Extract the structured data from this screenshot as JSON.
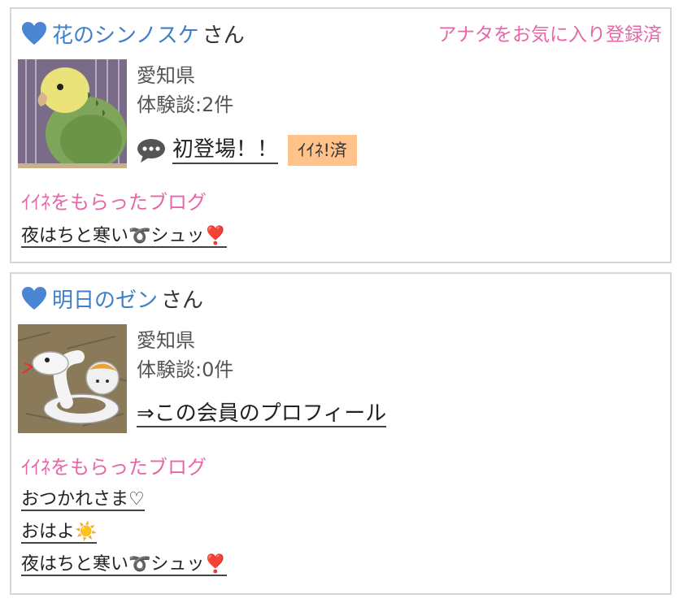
{
  "members": [
    {
      "name": "花のシンノスケ",
      "suffix": "さん",
      "favorite_status": "アナタをお気に入り登録済",
      "prefecture": "愛知県",
      "experience": "体験談:2件",
      "comment_link": "初登場！！",
      "iine_badge": "ｲｲﾈ!済",
      "blog_section_title": "ｲｲﾈをもらったブログ",
      "blogs": [
        "夜はちと寒い➰シュッ❣️"
      ]
    },
    {
      "name": "明日のゼン",
      "suffix": "さん",
      "prefecture": "愛知県",
      "experience": "体験談:0件",
      "profile_link": "⇒この会員のプロフィール",
      "blog_section_title": "ｲｲﾈをもらったブログ",
      "blogs": [
        "おつかれさま♡",
        "おはよ☀️",
        "夜はちと寒い➰シュッ❣️"
      ]
    }
  ],
  "colors": {
    "name_blue": "#3f7fc9",
    "accent_pink": "#e866a8",
    "badge_orange": "#ffc38a",
    "border_gray": "#d6d6d6"
  },
  "icons": {
    "heart": "heart-icon",
    "comment": "speech-bubble-icon"
  }
}
